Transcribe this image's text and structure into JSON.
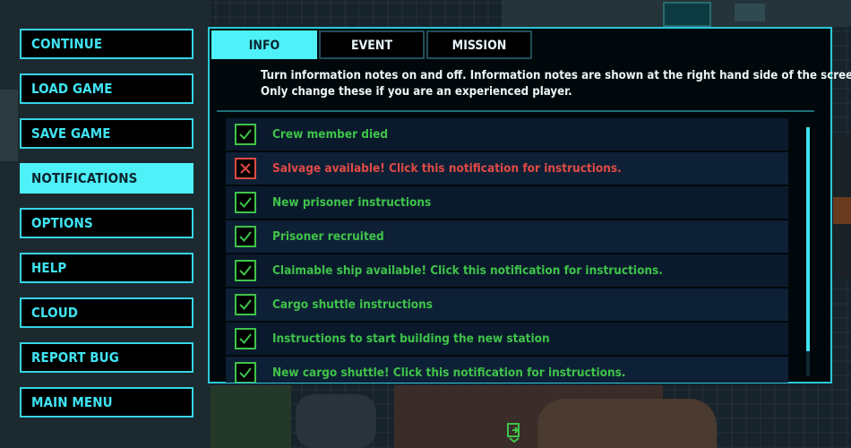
{
  "menu": {
    "items": [
      {
        "label": "CONTINUE",
        "active": false
      },
      {
        "label": "LOAD GAME",
        "active": false
      },
      {
        "label": "SAVE GAME",
        "active": false
      },
      {
        "label": "NOTIFICATIONS",
        "active": true
      },
      {
        "label": "OPTIONS",
        "active": false
      },
      {
        "label": "HELP",
        "active": false
      },
      {
        "label": "CLOUD",
        "active": false
      },
      {
        "label": "REPORT BUG",
        "active": false
      },
      {
        "label": "MAIN MENU",
        "active": false
      }
    ]
  },
  "panel": {
    "tabs": [
      {
        "label": "INFO",
        "active": true
      },
      {
        "label": "EVENT",
        "active": false
      },
      {
        "label": "MISSION",
        "active": false
      }
    ],
    "description_line1": "Turn information notes on and off. Information notes are shown at the right hand side of the screen.",
    "description_line2": "Only change these if you are an experienced player.",
    "notifications": [
      {
        "label": "Crew member died",
        "enabled": true
      },
      {
        "label": "Salvage available! Click this notification for instructions.",
        "enabled": false
      },
      {
        "label": "New prisoner instructions",
        "enabled": true
      },
      {
        "label": "Prisoner recruited",
        "enabled": true
      },
      {
        "label": "Claimable ship available! Click this notification for instructions.",
        "enabled": true
      },
      {
        "label": "Cargo shuttle instructions",
        "enabled": true
      },
      {
        "label": "Instructions to start building the new station",
        "enabled": true
      },
      {
        "label": "New cargo shuttle! Click this notification for instructions.",
        "enabled": true
      }
    ],
    "scroll_position": 0
  },
  "colors": {
    "accent": "#3fe3f2",
    "active_bg": "#4ef1f8",
    "enabled_green": "#3fc34a",
    "disabled_red": "#e04a45"
  },
  "icons": {
    "enabled": "checkmark-icon",
    "disabled": "cross-icon",
    "bottom": "exit-door-icon"
  }
}
